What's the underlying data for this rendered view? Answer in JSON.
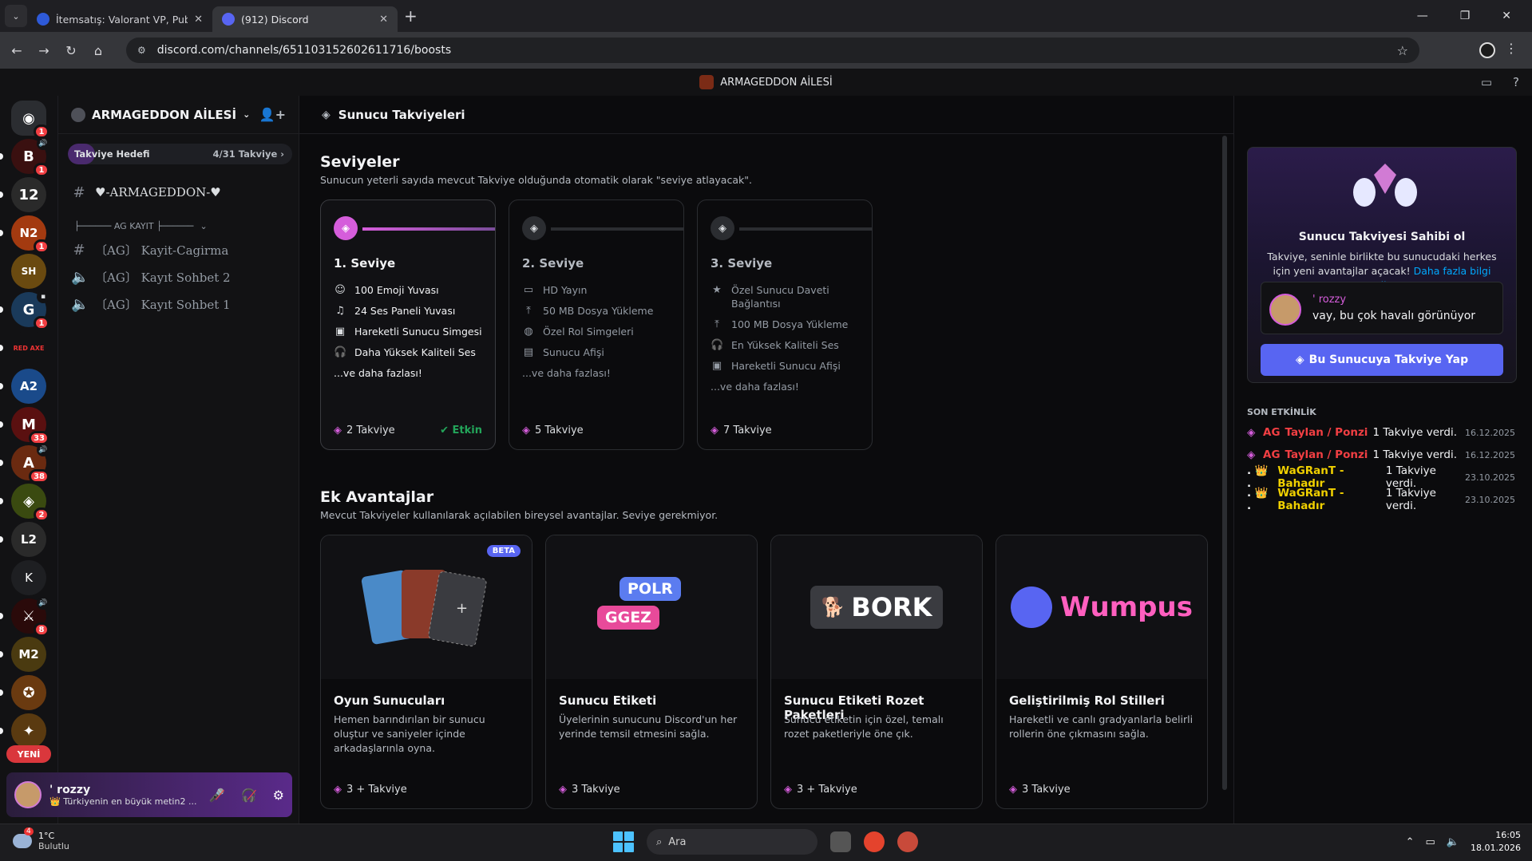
{
  "browser": {
    "tabs": [
      {
        "title": "İtemsatış: Valorant VP, Pubg Mo",
        "active": false
      },
      {
        "title": "(912) Discord",
        "active": true
      }
    ],
    "url": "discord.com/channels/651103152602611716/boosts"
  },
  "discord_top": {
    "server_name": "ARMAGEDDON AİLESİ"
  },
  "rail": {
    "new_label": "YENİ",
    "servers": [
      {
        "name": "discord-home",
        "label": "",
        "badge": "1",
        "color": "#2b2d31"
      },
      {
        "name": "server-b",
        "label": "B",
        "badge": "1",
        "color": "#3a1010"
      },
      {
        "name": "server-12",
        "label": "12",
        "badge": "",
        "color": "#2a2a2a"
      },
      {
        "name": "server-n2",
        "label": "N2",
        "badge": "1",
        "color": "#a33a10"
      },
      {
        "name": "server-shadow",
        "label": "SH",
        "badge": "",
        "color": "#6a4a10"
      },
      {
        "name": "server-g",
        "label": "G",
        "badge": "1",
        "color": "#1a3a5a"
      },
      {
        "name": "server-redaxe",
        "label": "RED AXE",
        "badge": "",
        "color": "#121214"
      },
      {
        "name": "server-a2",
        "label": "A2",
        "badge": "",
        "color": "#1a4a8a"
      },
      {
        "name": "server-m",
        "label": "M",
        "badge": "33",
        "color": "#5a1010"
      },
      {
        "name": "server-a",
        "label": "A",
        "badge": "38",
        "color": "#6a2a10"
      },
      {
        "name": "server-game",
        "label": "",
        "badge": "2",
        "color": "#3a4a10"
      },
      {
        "name": "server-l2",
        "label": "L2",
        "badge": "",
        "color": "#2a2a2a"
      },
      {
        "name": "server-k",
        "label": "K",
        "badge": "",
        "color": "#1e1f22"
      },
      {
        "name": "server-sword",
        "label": "",
        "badge": "8",
        "color": "#2a0a0a"
      },
      {
        "name": "server-m2",
        "label": "M2",
        "badge": "",
        "color": "#4a3a10"
      },
      {
        "name": "server-wolf",
        "label": "",
        "badge": "",
        "color": "#6a3a10"
      },
      {
        "name": "server-zafer",
        "label": "",
        "badge": "",
        "color": "#5a3a10"
      }
    ]
  },
  "channels": {
    "server_title": "ARMAGEDDON AİLESİ",
    "boost_goal_label": "Takviye Hedefi",
    "boost_goal_count": "4/31 Takviye",
    "top_channel": "♥-ARMAGEDDON-♥",
    "category": "├────── AG KAYIT ├──────",
    "items": [
      {
        "type": "text",
        "name": "〔AG〕 Kayit-Cagirma"
      },
      {
        "type": "voice",
        "name": "〔AG〕 Kayıt Sohbet 2"
      },
      {
        "type": "voice",
        "name": "〔AG〕 Kayıt Sohbet 1"
      }
    ]
  },
  "user_panel": {
    "name": "' rozzy",
    "status": "👑 Türkiyenin en büyük metin2 ..."
  },
  "main": {
    "header": "Sunucu Takviyeleri",
    "levels_title": "Seviyeler",
    "levels_sub": "Sunucun yeterli sayıda mevcut Takviye olduğunda otomatik olarak \"seviye atlayacak\".",
    "levels": [
      {
        "title": "1. Seviye",
        "perks": [
          "100 Emoji Yuvası",
          "24 Ses Paneli Yuvası",
          "Hareketli Sunucu Simgesi",
          "Daha Yüksek Kaliteli Ses"
        ],
        "more": "...ve daha fazlası!",
        "boosts": "2 Takviye",
        "status": "Etkin"
      },
      {
        "title": "2. Seviye",
        "perks": [
          "HD Yayın",
          "50 MB Dosya Yükleme",
          "Özel Rol Simgeleri",
          "Sunucu Afişi"
        ],
        "more": "...ve daha fazlası!",
        "boosts": "5 Takviye",
        "status": ""
      },
      {
        "title": "3. Seviye",
        "perks": [
          "Özel Sunucu Daveti Bağlantısı",
          "100 MB Dosya Yükleme",
          "En Yüksek Kaliteli Ses",
          "Hareketli Sunucu Afişi"
        ],
        "more": "...ve daha fazlası!",
        "boosts": "7 Takviye",
        "status": ""
      }
    ],
    "extra_title": "Ek Avantajlar",
    "extra_sub": "Mevcut Takviyeler kullanılarak açılabilen bireysel avantajlar. Seviye gerekmiyor.",
    "perks": [
      {
        "title": "Oyun Sunucuları",
        "desc": "Hemen barındırılan bir sunucu oluştur ve saniyeler içinde arkadaşlarınla oyna.",
        "cost": "3 + Takviye",
        "badge": "BETA"
      },
      {
        "title": "Sunucu Etiketi",
        "desc": "Üyelerinin sunucunu Discord'un her yerinde temsil etmesini sağla.",
        "cost": "3 Takviye",
        "badge": "",
        "art1": "POLR",
        "art2": "GGEZ"
      },
      {
        "title": "Sunucu Etiketi Rozet Paketleri",
        "desc": "Sunucu etiketin için özel, temalı rozet paketleriyle öne çık.",
        "cost": "3 + Takviye",
        "badge": "",
        "art1": "BORK"
      },
      {
        "title": "Geliştirilmiş Rol Stilleri",
        "desc": "Hareketli ve canlı gradyanlarla belirli rollerin öne çıkmasını sağla.",
        "cost": "3 Takviye",
        "badge": "",
        "art1": "Wumpus"
      }
    ]
  },
  "side": {
    "promo_title": "Sunucu Takviyesi Sahibi ol",
    "promo_desc": "Takviye, seninle birlikte bu sunucudaki herkes için yeni avantajlar açacak!",
    "promo_link": "Daha fazla bilgi edin",
    "msg_name": "' rozzy",
    "msg_text": "vay, bu çok havalı görünüyor",
    "button": "Bu Sunucuya Takviye Yap",
    "activity_title": "SON ETKİNLİK",
    "activity": [
      {
        "prefix": "AG",
        "who": "Taylan / Ponzi",
        "text": "1 Takviye verdi.",
        "date": "16.12.2025",
        "color": "#f23f43"
      },
      {
        "prefix": "AG",
        "who": "Taylan / Ponzi",
        "text": "1 Takviye verdi.",
        "date": "16.12.2025",
        "color": "#f23f43"
      },
      {
        "prefix": ". 👑 .",
        "who": "WaGRanT - Bahadır",
        "text": "1 Takviye verdi.",
        "date": "23.10.2025",
        "color": "#f0d000"
      },
      {
        "prefix": ". 👑 .",
        "who": "WaGRanT - Bahadır",
        "text": "1 Takviye verdi.",
        "date": "23.10.2025",
        "color": "#f0d000"
      }
    ]
  },
  "taskbar": {
    "temp": "1°C",
    "weather": "Bulutlu",
    "weather_badge": "4",
    "search": "Ara",
    "time": "16:05",
    "date": "18.01.2026"
  }
}
